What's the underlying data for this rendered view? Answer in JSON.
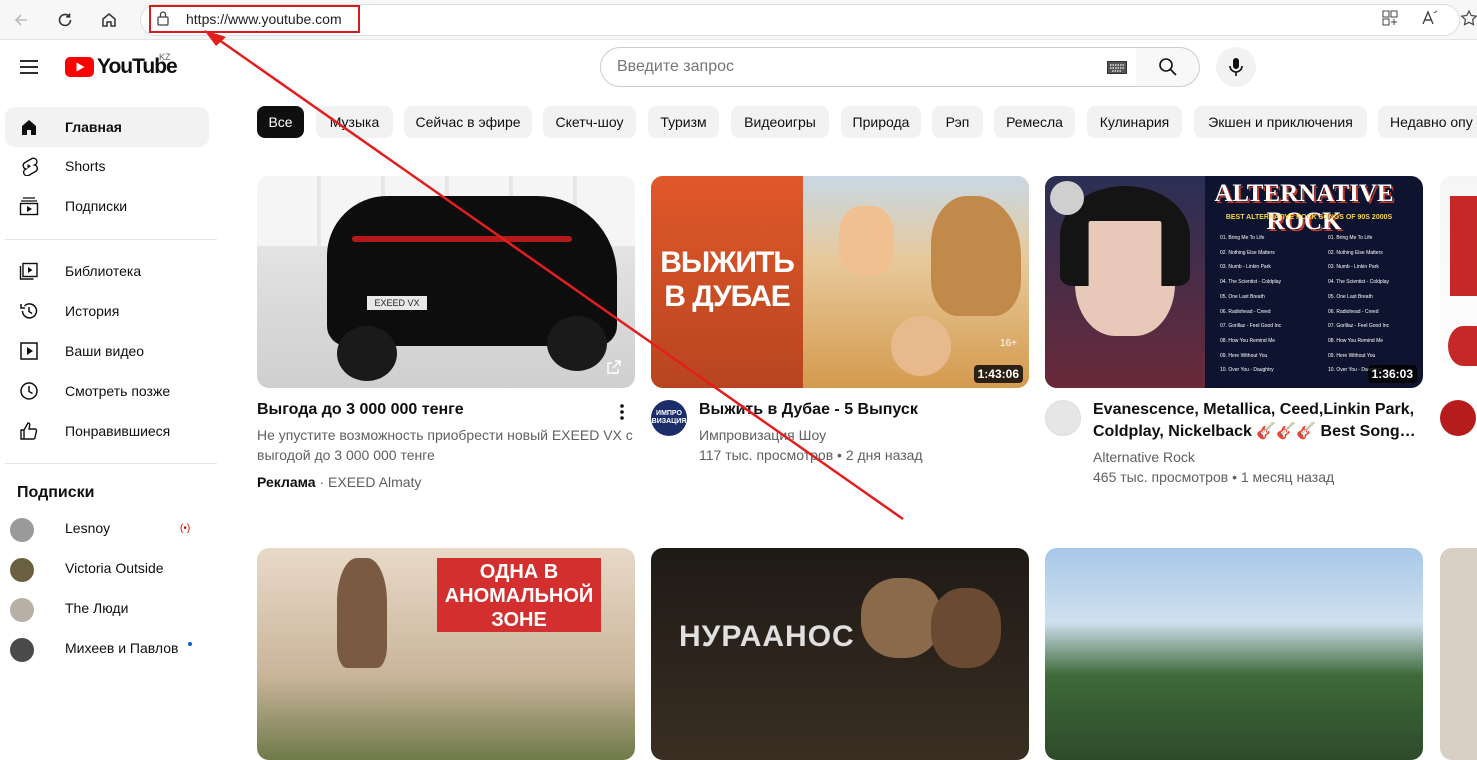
{
  "browser": {
    "url": "https://www.youtube.com"
  },
  "header": {
    "logo_text": "YouTube",
    "region": "KZ",
    "search_placeholder": "Введите запрос"
  },
  "sidebar": {
    "main": [
      {
        "label": "Главная",
        "icon": "home-icon"
      },
      {
        "label": "Shorts",
        "icon": "shorts-icon"
      },
      {
        "label": "Подписки",
        "icon": "subscriptions-icon"
      }
    ],
    "library": [
      {
        "label": "Библиотека",
        "icon": "library-icon"
      },
      {
        "label": "История",
        "icon": "history-icon"
      },
      {
        "label": "Ваши видео",
        "icon": "your-videos-icon"
      },
      {
        "label": "Смотреть позже",
        "icon": "watch-later-icon"
      },
      {
        "label": "Понравившиеся",
        "icon": "liked-icon"
      }
    ],
    "subscriptions_title": "Подписки",
    "subscriptions": [
      {
        "label": "Lesnoy",
        "live": "(•)"
      },
      {
        "label": "Victoria Outside"
      },
      {
        "label": "The Люди"
      },
      {
        "label": "Михеев и Павлов"
      }
    ]
  },
  "chips": [
    "Все",
    "Музыка",
    "Сейчас в эфире",
    "Скетч-шоу",
    "Туризм",
    "Видеоигры",
    "Природа",
    "Рэп",
    "Ремесла",
    "Кулинария",
    "Экшен и приключения",
    "Недавно опу"
  ],
  "videos": [
    {
      "thumb_label": "EXEED VX",
      "title": "Выгода до 3 000 000 тенге",
      "desc_1": "Не упустите возможность приобрести новый EXEED VX с",
      "desc_2": "выгодой до 3 000 000 тенге",
      "ad_label": "Реклама",
      "advertiser": " · EXEED Almaty"
    },
    {
      "thumb_text_1": "ВЫЖИТЬ",
      "thumb_text_2": "В ДУБАЕ",
      "age": "16+",
      "duration": "1:43:06",
      "title": "Выжить в Дубае - 5 Выпуск",
      "channel": "Импровизация Шоу",
      "avatar_text": "ИМПРО ВИЗАЦИЯ",
      "meta": "117 тыс. просмотров • 2 дня назад"
    },
    {
      "thumb_title": "ALTERNATIVE ROCK",
      "thumb_subtitle": "BEST ALTERNATIVE ROCK SONGS OF 90S 2000S",
      "tracks": [
        "01. Bring Me To Life",
        "02. Nothing Else Matters",
        "03. Numb - Linkin Park",
        "04. The Scientist - Coldplay",
        "05. One Last Breath",
        "06. Radiohead - Creed",
        "07. Gorillaz - Feel Good Inc",
        "08. How You Remind Me",
        "09. Here Without You",
        "10. Over You - Daughtry"
      ],
      "duration": "1:36:03",
      "title_1": "Evanescence, Metallica, Ceed,Linkin Park,",
      "title_2": "Coldplay, Nickelback 🎸🎸🎸 Best Song…",
      "channel": "Alternative Rock",
      "meta": "465 тыс. просмотров • 1 месяц назад"
    }
  ],
  "row2": [
    {
      "thumb_text": "ОДНА В АНОМАЛЬНОЙ ЗОНЕ"
    },
    {
      "thumb_text": "НУРААНОС"
    },
    {
      "thumb_text": ""
    }
  ],
  "colors": {
    "accent": "#ff0000",
    "annotation": "#e31e1e"
  }
}
